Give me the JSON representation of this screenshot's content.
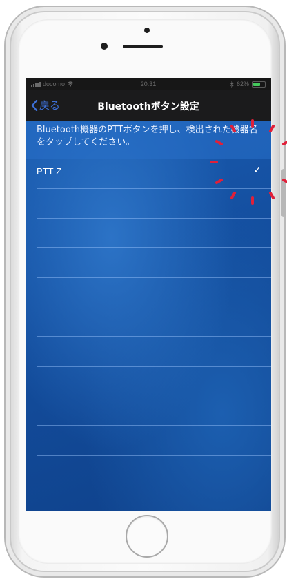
{
  "status_bar": {
    "carrier": "docomo",
    "time": "20:31",
    "battery": "62%"
  },
  "nav": {
    "back_label": "戻る",
    "title": "Bluetoothボタン設定"
  },
  "instruction": "Bluetooth機器のPTTボタンを押し、検出された機器名をタップしてください。",
  "devices": [
    {
      "name": "PTT-Z",
      "checked": true,
      "check_mark": "✓"
    }
  ],
  "colors": {
    "accent": "#3d6fd6",
    "background": "#124b98",
    "spinner": "#e0203a"
  }
}
